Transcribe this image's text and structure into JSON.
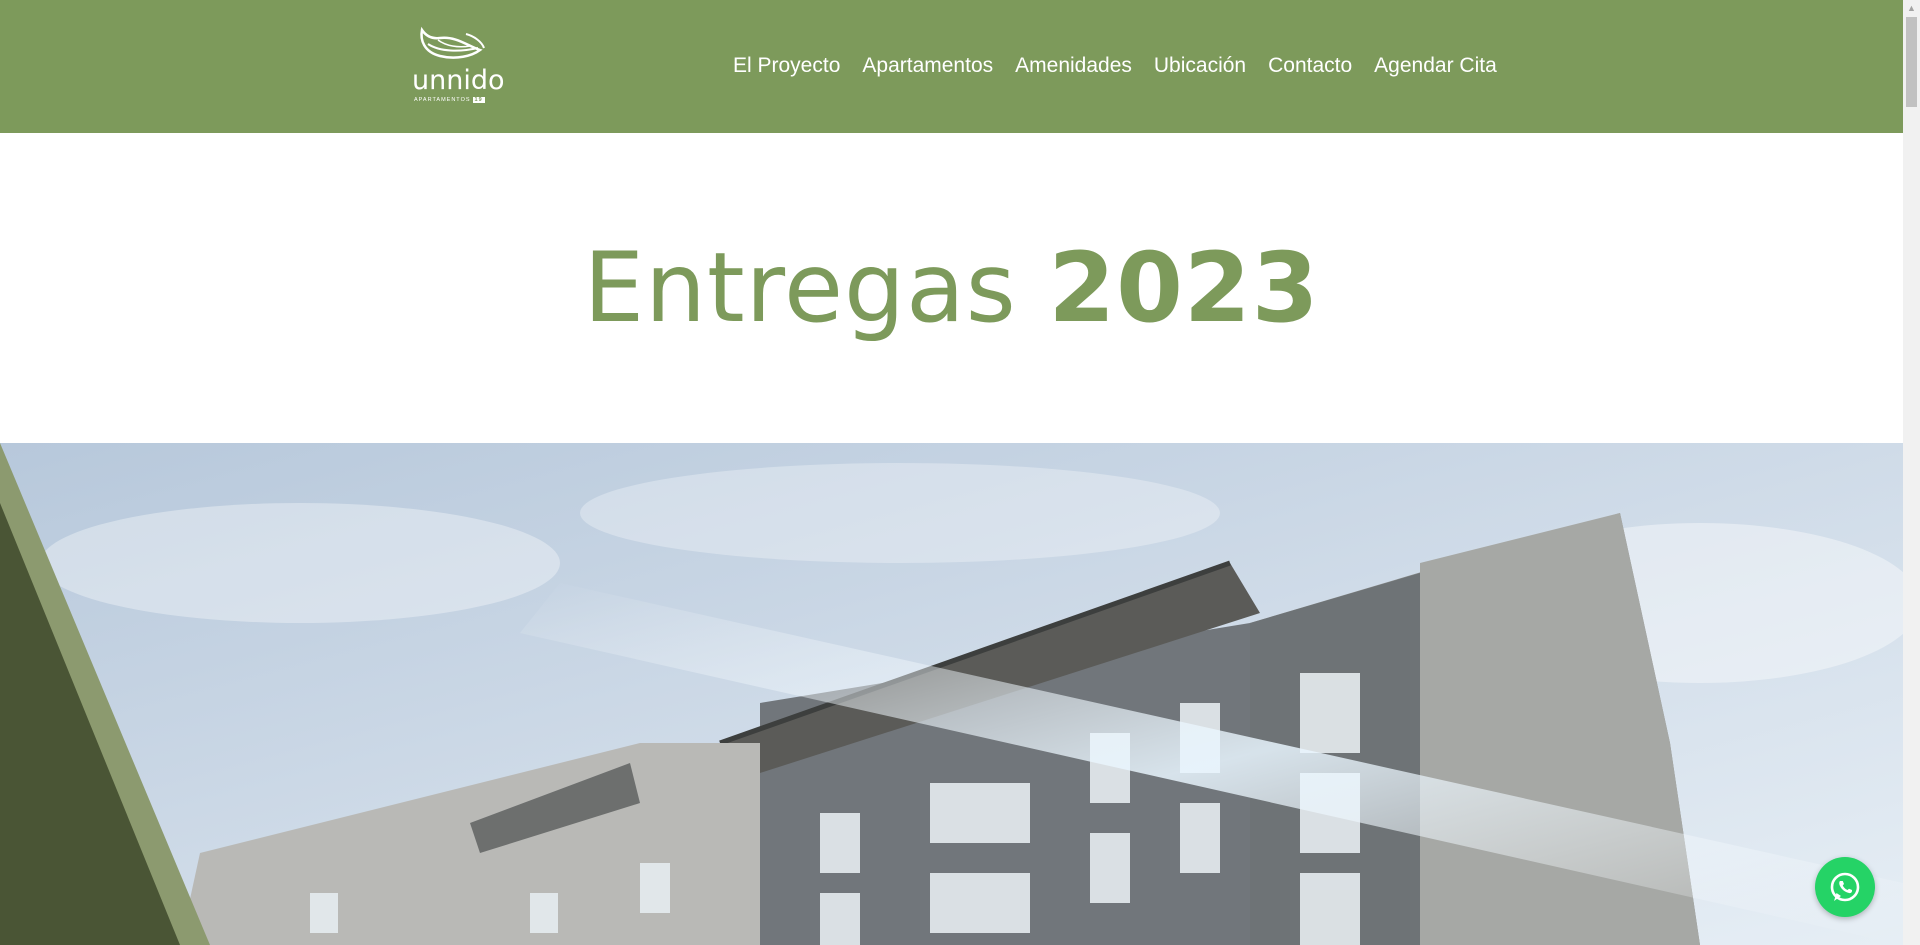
{
  "brand": {
    "name": "unnido",
    "subtitle": "APARTAMENTOS",
    "badge": "19"
  },
  "nav": {
    "items": [
      {
        "label": "El Proyecto"
      },
      {
        "label": "Apartamentos"
      },
      {
        "label": "Amenidades"
      },
      {
        "label": "Ubicación"
      },
      {
        "label": "Contacto"
      },
      {
        "label": "Agendar Cita"
      }
    ]
  },
  "hero": {
    "title_light": "Entregas",
    "title_bold": "2023"
  },
  "colors": {
    "brand_green": "#7d9a5b",
    "dark_olive": "#4a5535",
    "whatsapp": "#25d366"
  },
  "icons": {
    "logo": "leaf-nest-icon",
    "chat": "whatsapp-icon",
    "scroll_up": "arrow-up-icon"
  }
}
